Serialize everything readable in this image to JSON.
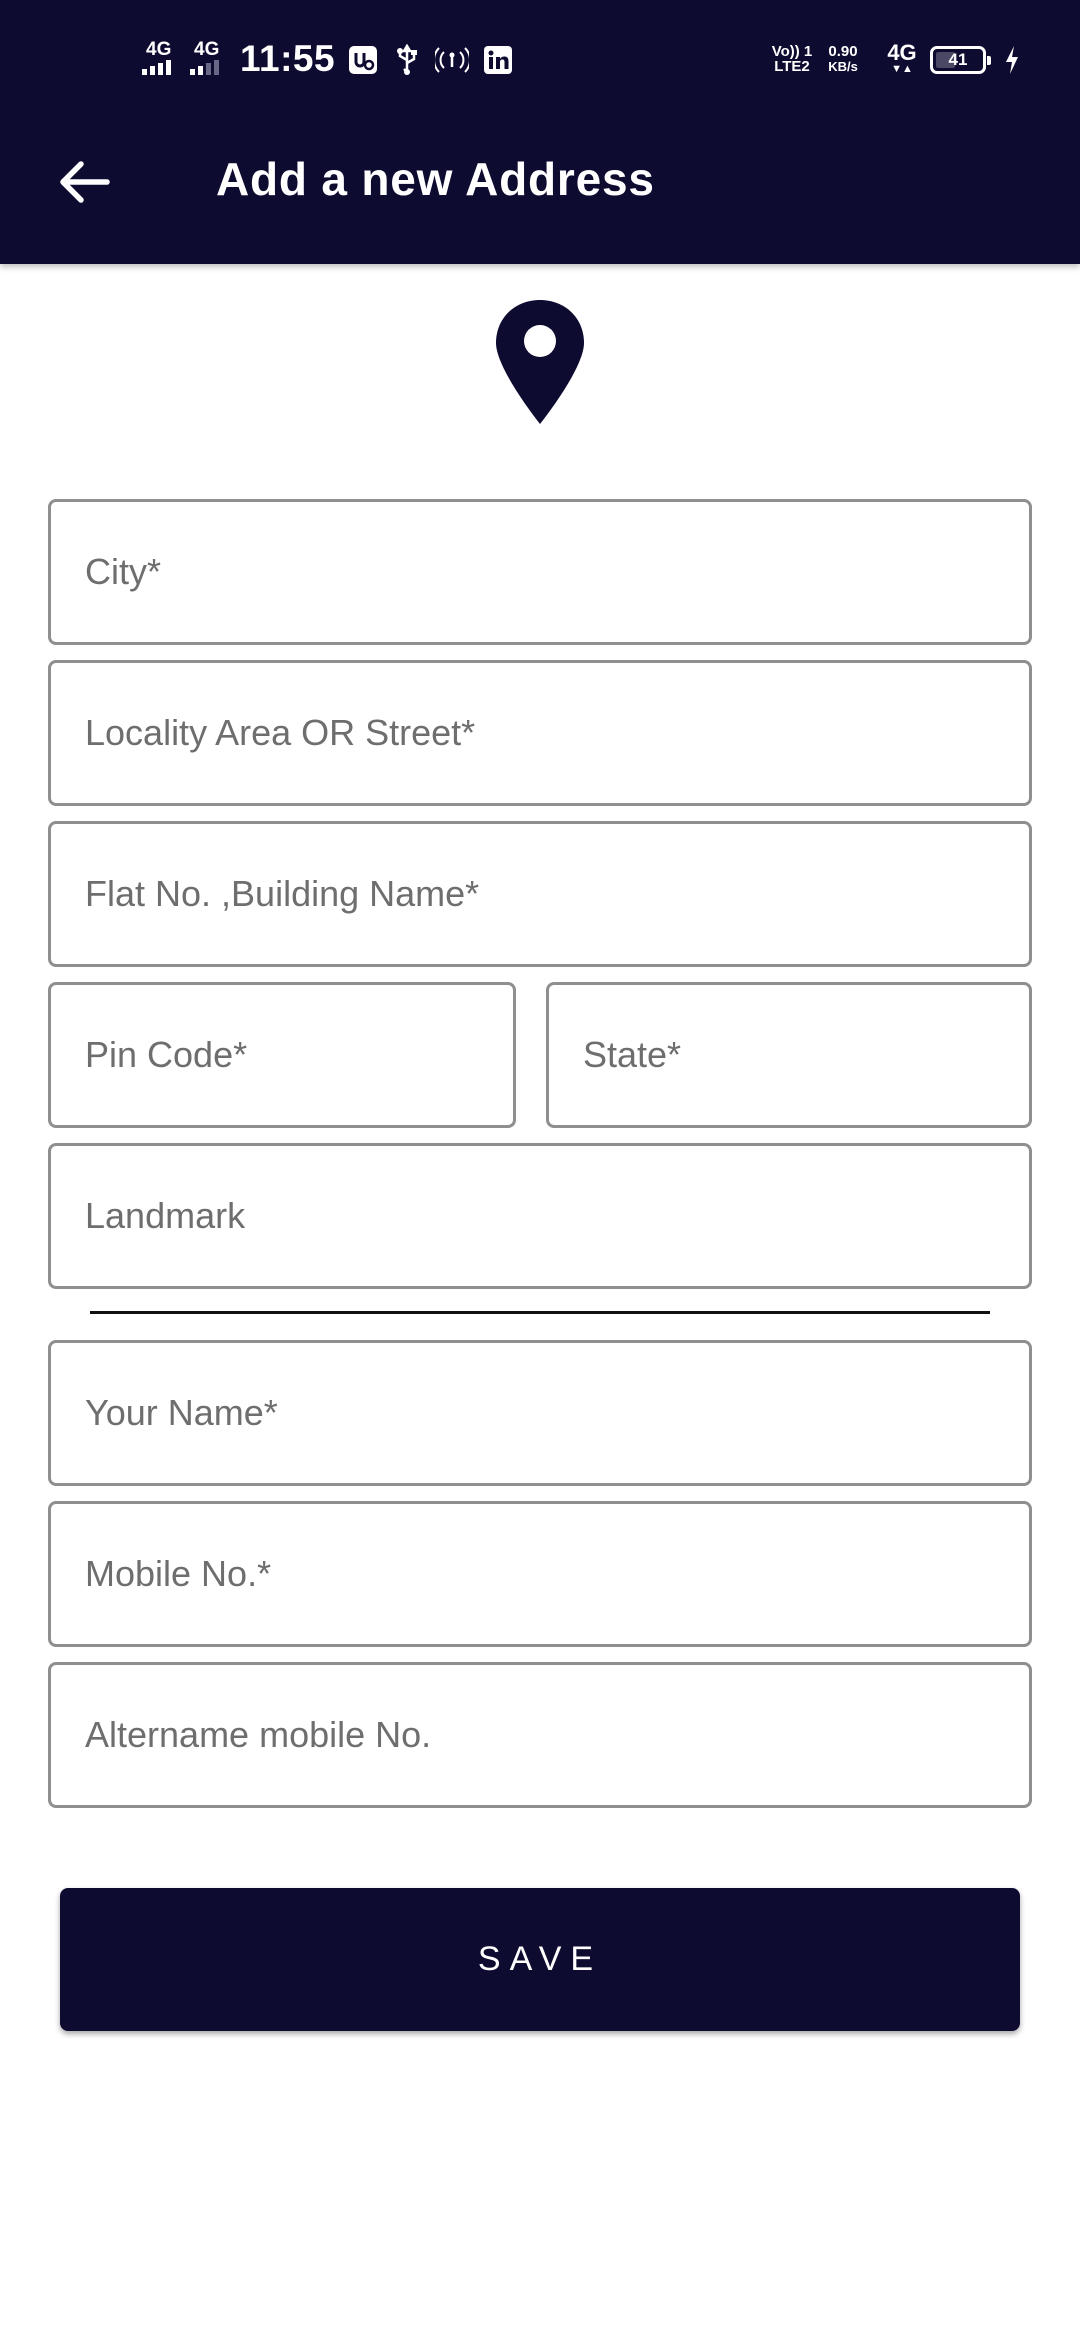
{
  "status_bar": {
    "time": "11:55",
    "net1": "4G",
    "net2": "4G",
    "volte": "Vo)) 1",
    "lte": "LTE2",
    "speed_value": "0.90",
    "speed_unit": "KB/s",
    "net3": "4G",
    "battery": "41"
  },
  "header": {
    "title": "Add a new Address"
  },
  "form": {
    "city_placeholder": "City*",
    "locality_placeholder": "Locality Area OR Street*",
    "flat_placeholder": "Flat No. ,Building Name*",
    "pincode_placeholder": "Pin Code*",
    "state_placeholder": "State*",
    "landmark_placeholder": "Landmark",
    "name_placeholder": "Your Name*",
    "mobile_placeholder": "Mobile No.*",
    "alt_mobile_placeholder": "Altername mobile No.",
    "save_label": "SAVE"
  },
  "colors": {
    "primary": "#0e0b30",
    "field_border": "#8f8f8f",
    "placeholder": "#6e6e6e"
  }
}
